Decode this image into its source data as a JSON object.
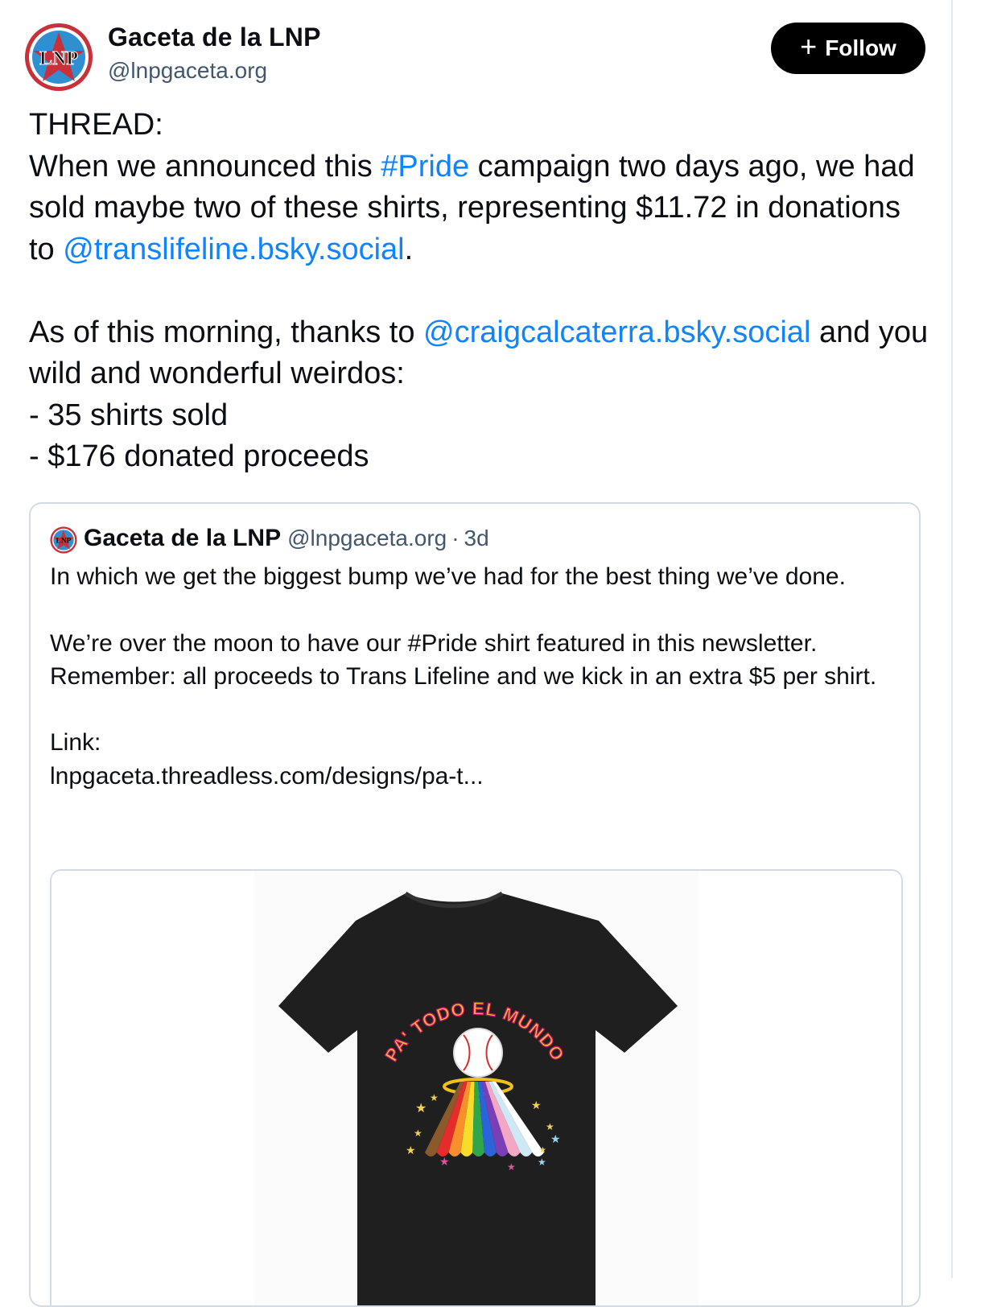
{
  "author": {
    "name": "Gaceta de la LNP",
    "handle": "@lnpgaceta.org",
    "avatar_text": "LNP"
  },
  "follow_button": {
    "label": "Follow"
  },
  "post": {
    "line1": "THREAD:",
    "p1_a": "When we announced this ",
    "p1_tag": "#Pride",
    "p1_b": " campaign two days ago, we had sold maybe two of these shirts, representing $11.72 in donations to ",
    "p1_mention": "@translifeline.bsky.social",
    "p1_c": ".",
    "p2_a": "As of this morning, thanks to ",
    "p2_mention": "@craigcalcaterra.bsky.social",
    "p2_b": " and you wild and wonderful weirdos:",
    "item1": "- 35 shirts sold",
    "item2": "- $176 donated proceeds"
  },
  "quote": {
    "name": "Gaceta de la LNP",
    "handle": "@lnpgaceta.org",
    "separator": "·",
    "time": "3d",
    "text": "In which we get the biggest bump we’ve had for the best thing we’ve done.\n\nWe’re over the moon to have our #Pride shirt featured in this newsletter. Remember: all proceeds to Trans Lifeline and we kick in an extra $5 per shirt.\n\nLink:\nlnpgaceta.threadless.com/designs/pa-t..."
  },
  "shirt": {
    "arc_text": "PA' TODO EL MUNDO",
    "rainbow_colors": [
      "#8b5a2b",
      "#e52b2b",
      "#f7902a",
      "#f6dd2a",
      "#2fa64a",
      "#2b63d9",
      "#7a3fb6",
      "#f2a7c4",
      "#cfe8f5",
      "#ffffff"
    ]
  },
  "colors": {
    "link": "#1083fe",
    "muted": "#42576c",
    "border": "#d4dbe2"
  }
}
